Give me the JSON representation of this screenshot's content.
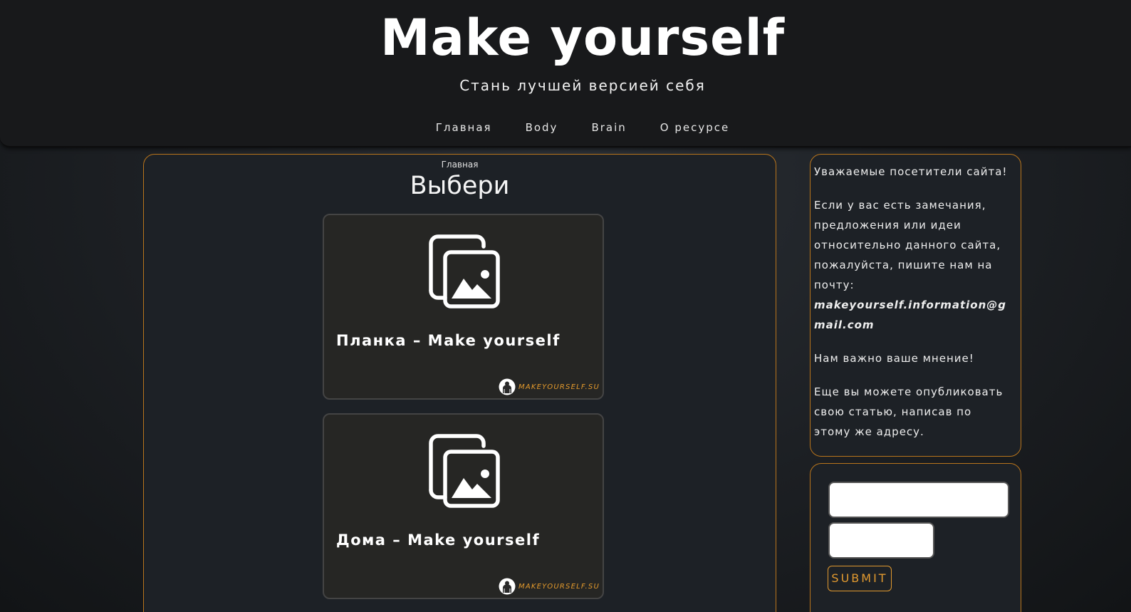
{
  "header": {
    "title": "Make yourself",
    "tagline": "Стань лучшей версией себя",
    "nav": [
      {
        "label": "Главная"
      },
      {
        "label": "Body"
      },
      {
        "label": "Brain"
      },
      {
        "label": "О ресурсе"
      }
    ]
  },
  "main": {
    "breadcrumb": "Главная",
    "heading": "Выбери",
    "cards": [
      {
        "title": "Планка – Make yourself",
        "image_icon": "image-gallery-icon",
        "brand": "MAKEYOURSELF.SU"
      },
      {
        "title": "Дома – Make yourself",
        "image_icon": "image-gallery-icon",
        "brand": "MAKEYOURSELF.SU"
      }
    ]
  },
  "sidebar": {
    "greeting": "Уважаемые посетители сайта!",
    "message": "Если у вас есть замечания, предложения или идеи относительно данного сайта, пожалуйста, пишите нам на почту:",
    "email": "makeyourself.information@gmail.com",
    "importance": "Нам важно ваше мнение!",
    "publish": "Еще вы можете опубликовать свою статью, написав по этому же адресу.",
    "form": {
      "submit_label": "SUBMIT"
    }
  },
  "colors": {
    "accent": "#e29a2f",
    "panel_border": "#b9751c",
    "panel_bg": "#1d2126",
    "card_bg": "#262624",
    "header_bg": "#18191b"
  }
}
